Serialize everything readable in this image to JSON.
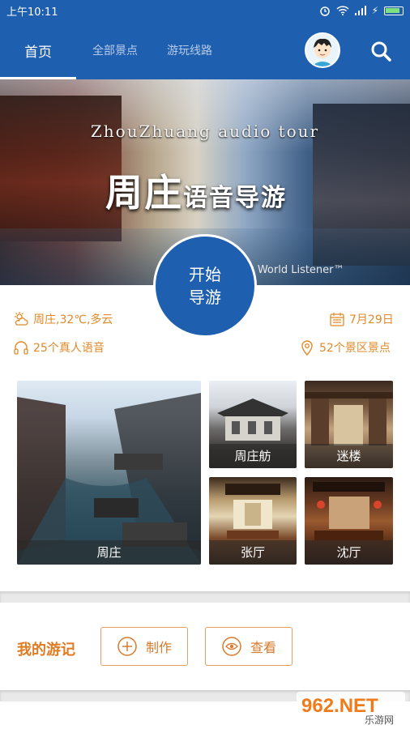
{
  "status_bar": {
    "time": "上午10:11"
  },
  "nav": {
    "tabs": [
      {
        "label": "首页",
        "active": true
      },
      {
        "label": "全部景点",
        "active": false
      },
      {
        "label": "游玩线路",
        "active": false
      }
    ],
    "avatar_icon": "user-avatar",
    "search_icon": "search-icon"
  },
  "banner": {
    "title_en": "ZhouZhuang audio tour",
    "title_cn_main": "周庄",
    "title_cn_small": "语音导游",
    "subtitle": "y World Listener™"
  },
  "start_button": {
    "line1": "开始",
    "line2": "导游"
  },
  "info": {
    "weather": "周庄,32℃,多云",
    "date": "7月29日",
    "voices": "25个真人语音",
    "spots": "52个景区景点"
  },
  "tiles": {
    "zhouzhuang": "周庄",
    "fang": "周庄舫",
    "milou": "迷楼",
    "zhangting": "张厅",
    "shenting": "沈厅"
  },
  "journal": {
    "title": "我的游记",
    "create_label": "制作",
    "view_label": "查看"
  },
  "watermark": {
    "text_top": "962.NET",
    "text_bottom": "乐游网"
  },
  "colors": {
    "brand_blue": "#1f5fb0",
    "accent_orange": "#e07b22"
  }
}
